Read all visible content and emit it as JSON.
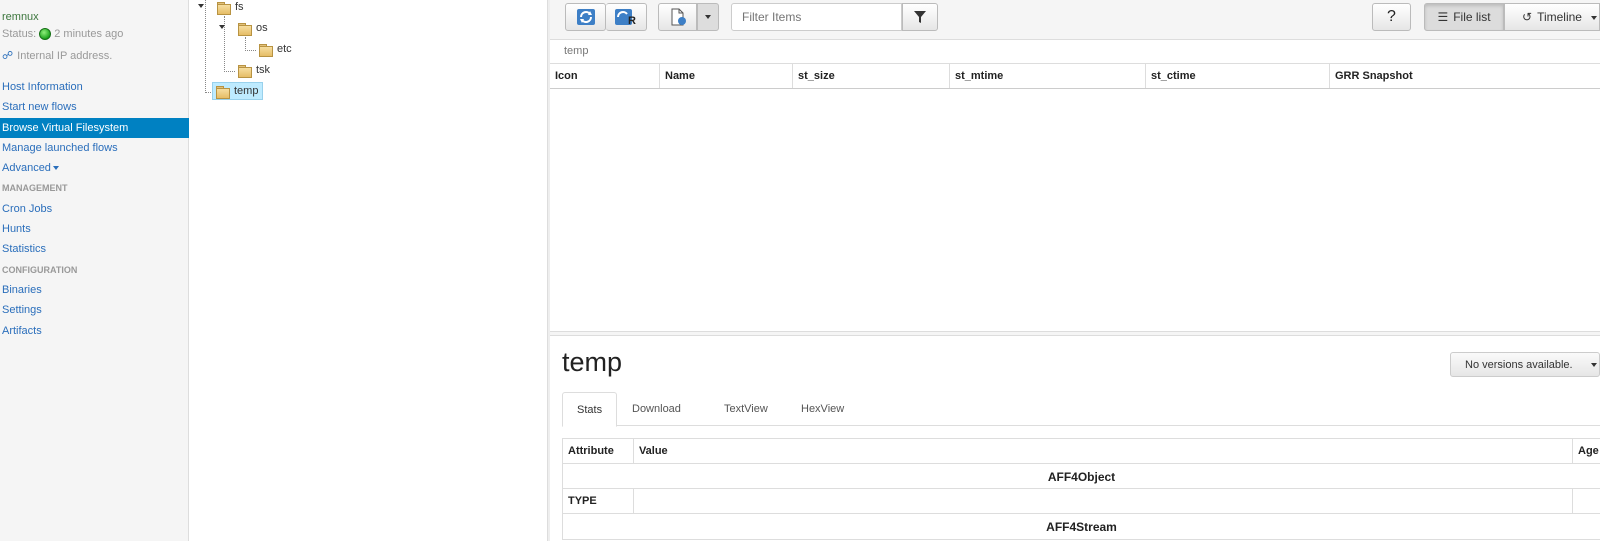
{
  "sidebar": {
    "hostname": "remnux",
    "status_label": "Status:",
    "status_time": "2 minutes ago",
    "ip_text": "Internal IP address.",
    "items": [
      {
        "label": "Host Information",
        "type": "link"
      },
      {
        "label": "Start new flows",
        "type": "link"
      },
      {
        "label": "Browse Virtual Filesystem",
        "type": "active"
      },
      {
        "label": "Manage launched flows",
        "type": "link"
      },
      {
        "label": "Advanced",
        "type": "dropdown"
      },
      {
        "label": "MANAGEMENT",
        "type": "header"
      },
      {
        "label": "Cron Jobs",
        "type": "link"
      },
      {
        "label": "Hunts",
        "type": "link"
      },
      {
        "label": "Statistics",
        "type": "link"
      },
      {
        "label": "CONFIGURATION",
        "type": "header"
      },
      {
        "label": "Binaries",
        "type": "link"
      },
      {
        "label": "Settings",
        "type": "link"
      },
      {
        "label": "Artifacts",
        "type": "link"
      }
    ]
  },
  "tree": {
    "fs": "fs",
    "os": "os",
    "etc": "etc",
    "tsk": "tsk",
    "temp": "temp"
  },
  "toolbar": {
    "filter_placeholder": "Filter Items",
    "file_list": "File list",
    "timeline": "Timeline",
    "help": "?"
  },
  "breadcrumb": "temp",
  "file_table": {
    "columns": [
      "Icon",
      "Name",
      "st_size",
      "st_mtime",
      "st_ctime",
      "GRR Snapshot"
    ]
  },
  "detail": {
    "title": "temp",
    "versions": "No versions available.",
    "tabs": [
      "Stats",
      "Download",
      "TextView",
      "HexView"
    ],
    "stats": {
      "headers": [
        "Attribute",
        "Value",
        "Age"
      ],
      "section1": "AFF4Object",
      "row_type": "TYPE",
      "section2": "AFF4Stream"
    }
  },
  "colors": {
    "accent": "#0081c2",
    "link": "#2a6ebb",
    "status_online": "#1ea51e"
  }
}
